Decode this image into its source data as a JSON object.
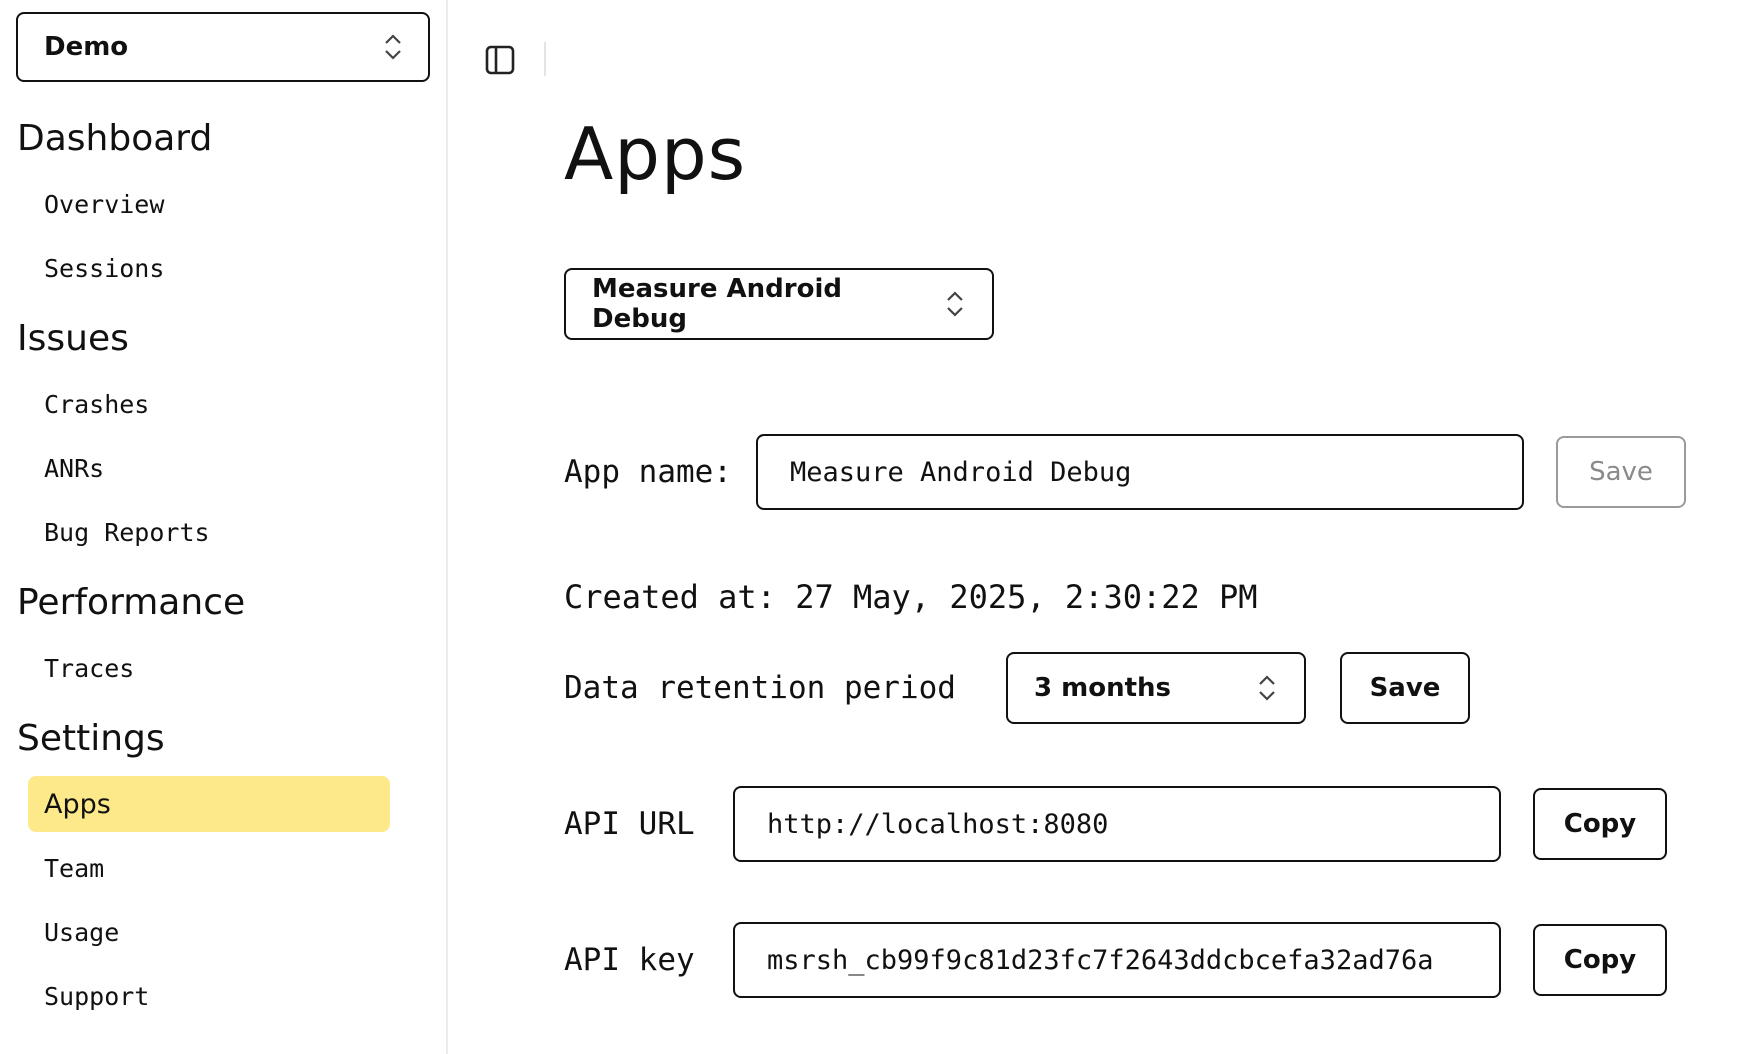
{
  "sidebar": {
    "team_select": {
      "value": "Demo",
      "icon": "chevron-updown-icon"
    },
    "sections": [
      {
        "title": "Dashboard",
        "items": [
          {
            "label": "Overview"
          },
          {
            "label": "Sessions"
          }
        ]
      },
      {
        "title": "Issues",
        "items": [
          {
            "label": "Crashes"
          },
          {
            "label": "ANRs"
          },
          {
            "label": "Bug Reports"
          }
        ]
      },
      {
        "title": "Performance",
        "items": [
          {
            "label": "Traces"
          }
        ]
      },
      {
        "title": "Settings",
        "items": [
          {
            "label": "Apps",
            "active": true
          },
          {
            "label": "Team"
          },
          {
            "label": "Usage"
          },
          {
            "label": "Support"
          }
        ]
      }
    ]
  },
  "toolbar": {
    "sidebar_toggle_icon": "sidebar-toggle-icon"
  },
  "main": {
    "title": "Apps",
    "app_select": {
      "value": "Measure Android Debug"
    },
    "app_name": {
      "label": "App name:",
      "value": "Measure Android Debug",
      "save_label": "Save"
    },
    "created_at": "Created at: 27 May, 2025, 2:30:22 PM",
    "retention": {
      "label": "Data retention period",
      "value": "3 months",
      "save_label": "Save"
    },
    "api_url": {
      "label": "API URL",
      "value": "http://localhost:8080",
      "copy_label": "Copy"
    },
    "api_key": {
      "label": "API key",
      "value": "msrsh_cb99f9c81d23fc7f2643ddcbcefa32ad76a",
      "copy_label": "Copy"
    }
  },
  "colors": {
    "active_nav_bg": "#fde98a",
    "border": "#111111",
    "disabled": "#9a9a9a"
  }
}
